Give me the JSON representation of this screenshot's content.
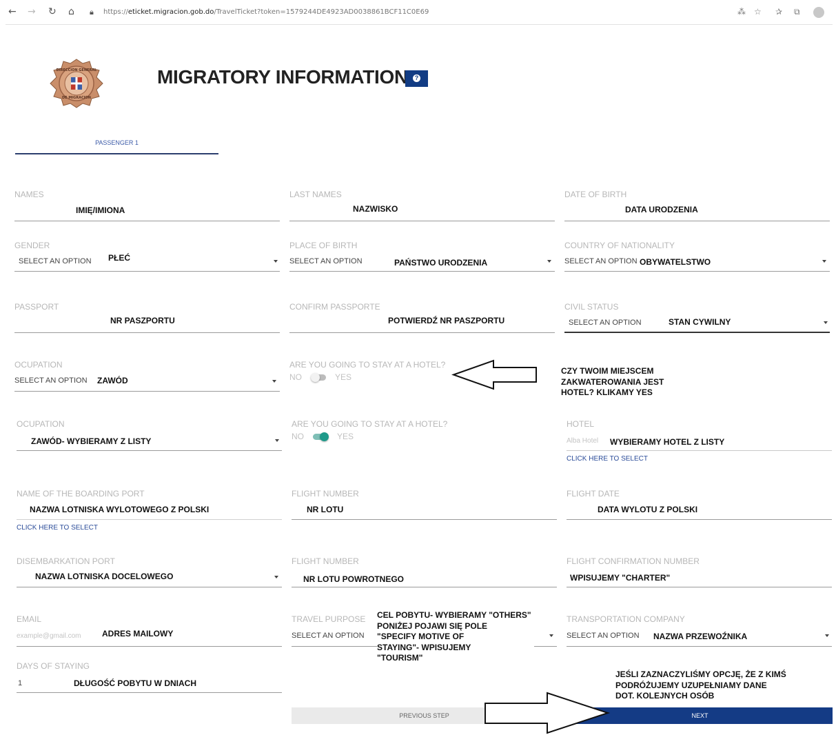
{
  "browser": {
    "url_prefix": "https://",
    "url_host": "eticket.migracion.gob.do",
    "url_path": "/TravelTicket?token=1579244DE4923AD0038861BCF11C0E69"
  },
  "header": {
    "title": "MIGRATORY INFORMATION",
    "help_icon": "?",
    "seal_text_top": "DIRECCION GENERAL",
    "seal_text_bottom": "DE MIGRACION"
  },
  "tabs": {
    "passenger_1": "PASSENGER 1"
  },
  "fields": {
    "names": {
      "label": "NAMES",
      "annotation": "IMIĘ/IMIONA"
    },
    "last_names": {
      "label": "LAST NAMES",
      "annotation": "NAZWISKO"
    },
    "dob": {
      "label": "DATE OF BIRTH",
      "annotation": "DATA URODZENIA"
    },
    "gender": {
      "label": "GENDER",
      "placeholder": "SELECT AN OPTION",
      "annotation": "PŁEĆ"
    },
    "place_of_birth": {
      "label": "PLACE OF BIRTH",
      "placeholder": "SELECT AN OPTION",
      "annotation": "PAŃSTWO URODZENIA"
    },
    "nationality": {
      "label": "COUNTRY OF NATIONALITY",
      "placeholder": "SELECT AN OPTION",
      "annotation": "OBYWATELSTWO"
    },
    "passport": {
      "label": "PASSPORT",
      "annotation": "NR PASZPORTU"
    },
    "confirm_passport": {
      "label": "CONFIRM PASSPORTE",
      "annotation": "POTWIERDŹ NR PASZPORTU"
    },
    "civil_status": {
      "label": "CIVIL STATUS",
      "placeholder": "SELECT AN OPTION",
      "annotation": "STAN CYWILNY"
    },
    "occupation_1": {
      "label": "OCUPATION",
      "placeholder": "SELECT AN OPTION",
      "annotation": "ZAWÓD"
    },
    "hotel_toggle_1": {
      "label": "ARE YOU GOING TO STAY AT A HOTEL?",
      "no": "NO",
      "yes": "YES",
      "state": "off"
    },
    "hotel_note": {
      "lines": [
        "CZY TWOIM MIEJSCEM",
        "ZAKWATEROWANIA JEST",
        "HOTEL? KLIKAMY YES"
      ]
    },
    "occupation_2": {
      "label": "OCUPATION",
      "annotation": "ZAWÓD- WYBIERAMY Z LISTY"
    },
    "hotel_toggle_2": {
      "label": "ARE YOU GOING TO STAY AT A HOTEL?",
      "no": "NO",
      "yes": "YES",
      "state": "on"
    },
    "hotel": {
      "label": "HOTEL",
      "placeholder": "Alba Hotel",
      "annotation": "WYBIERAMY HOTEL Z LISTY",
      "link": "CLICK HERE TO SELECT"
    },
    "boarding_port": {
      "label": "NAME OF THE BOARDING PORT",
      "annotation": "NAZWA LOTNISKA WYLOTOWEGO Z POLSKI",
      "link": "CLICK HERE TO SELECT"
    },
    "flight_number_1": {
      "label": "FLIGHT NUMBER",
      "annotation": "NR LOTU"
    },
    "flight_date": {
      "label": "FLIGHT DATE",
      "annotation": "DATA WYLOTU Z POLSKI"
    },
    "disembarkation_port": {
      "label": "DISEMBARKATION PORT",
      "annotation": "NAZWA LOTNISKA DOCELOWEGO"
    },
    "flight_number_2": {
      "label": "FLIGHT NUMBER",
      "annotation": "NR LOTU POWROTNEGO"
    },
    "flight_confirmation": {
      "label": "FLIGHT CONFIRMATION NUMBER",
      "annotation": "WPISUJEMY \"CHARTER\""
    },
    "email": {
      "label": "EMAIL",
      "placeholder": "example@gmail.com",
      "annotation": "ADRES MAILOWY"
    },
    "travel_purpose": {
      "label": "TRAVEL PURPOSE",
      "placeholder": "SELECT AN OPTION",
      "note": [
        "CEL POBYTU- WYBIERAMY \"OTHERS\"",
        "PONIŻEJ POJAWI SIĘ POLE",
        "\"SPECIFY MOTIVE OF",
        "STAYING\"- WPISUJEMY",
        "\"TOURISM\""
      ]
    },
    "transport_company": {
      "label": "TRANSPORTATION COMPANY",
      "placeholder": "SELECT AN OPTION",
      "annotation": "NAZWA PRZEWOŹNIKA"
    },
    "days_of_staying": {
      "label": "DAYS OF STAYING",
      "value": "1",
      "annotation": "DŁUGOŚĆ POBYTU W DNIACH"
    }
  },
  "companions_note": {
    "lines": [
      "JEŚLI ZAZNACZYLIŚMY OPCJĘ, ŻE Z KIMŚ",
      "PODRÓŻUJEMY UZUPEŁNIAMY DANE",
      "DOT. KOLEJNYCH OSÓB"
    ]
  },
  "buttons": {
    "previous": "PREVIOUS STEP",
    "next": "NEXT"
  },
  "colors": {
    "primary": "#143b85",
    "toggle_on": "#1f9a8a"
  }
}
